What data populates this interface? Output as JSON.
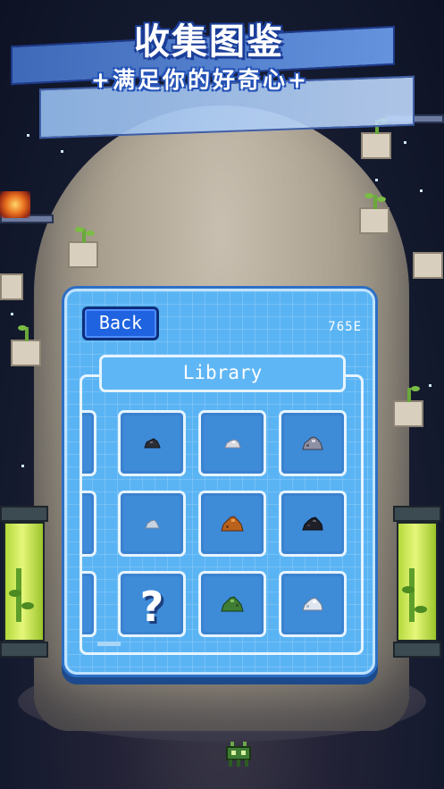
{
  "banner": {
    "title": "收集图鉴",
    "subtitle": "+满足你的好奇心+"
  },
  "panel": {
    "back_label": "Back",
    "energy": "765E",
    "tab_label": "Library"
  },
  "library": {
    "rows": [
      {
        "items": [
          {
            "type": "rock",
            "icon": "dark-rock-icon",
            "color": "#2c2d35"
          },
          {
            "type": "rock",
            "icon": "silver-rock-icon",
            "color": "#d9d9e2"
          },
          {
            "type": "rock",
            "icon": "gray-rock-icon",
            "color": "#8e90a3"
          }
        ]
      },
      {
        "items": [
          {
            "type": "rock",
            "icon": "pale-rock-icon",
            "color": "#c7d3e3"
          },
          {
            "type": "rock",
            "icon": "copper-rock-icon",
            "color": "#b8621d"
          },
          {
            "type": "rock",
            "icon": "black-rock-icon",
            "color": "#1f2028"
          }
        ]
      },
      {
        "items": [
          {
            "type": "unknown",
            "icon": "question-mark-icon",
            "label": "?"
          },
          {
            "type": "rock",
            "icon": "green-rock-icon",
            "color": "#3f7d34"
          },
          {
            "type": "rock",
            "icon": "white-rock-icon",
            "color": "#dfe6f0"
          }
        ]
      }
    ]
  },
  "colors": {
    "panel": "#5ab4f4",
    "panel_border": "#2d6fc4",
    "button": "#1f63e0",
    "cell": "#3a82cf",
    "tube_liquid": "#d6ef66"
  }
}
